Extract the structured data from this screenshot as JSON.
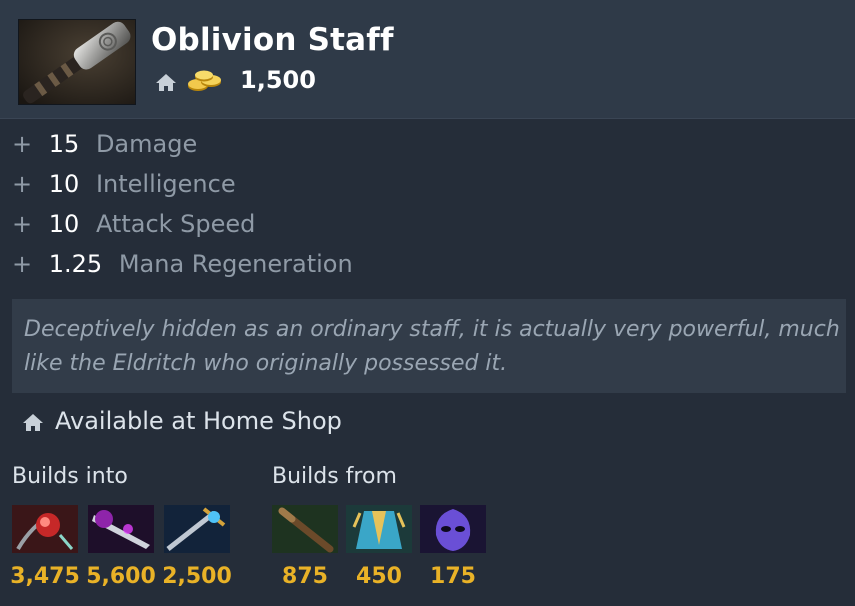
{
  "item": {
    "name": "Oblivion Staff",
    "cost": "1,500",
    "icon": "staff-icon"
  },
  "attributes": [
    {
      "plus": "+",
      "value": "15",
      "name": "Damage"
    },
    {
      "plus": "+",
      "value": "10",
      "name": "Intelligence"
    },
    {
      "plus": "+",
      "value": "10",
      "name": "Attack Speed"
    },
    {
      "plus": "+",
      "value": "1.25",
      "name": "Mana Regeneration"
    }
  ],
  "lore": "Deceptively hidden as an ordinary staff, it is actually very powerful, much like the Eldritch who originally possessed it.",
  "availability": "Available at Home Shop",
  "builds_into": {
    "label": "Builds into",
    "items": [
      {
        "icon": "red-orb-item-icon",
        "price": "3,475"
      },
      {
        "icon": "purple-blade-item-icon",
        "price": "5,600"
      },
      {
        "icon": "blue-sword-item-icon",
        "price": "2,500"
      }
    ]
  },
  "builds_from": {
    "label": "Builds from",
    "items": [
      {
        "icon": "quarterstaff-icon",
        "price": "875"
      },
      {
        "icon": "robe-icon",
        "price": "450"
      },
      {
        "icon": "mask-icon",
        "price": "175"
      }
    ]
  },
  "colors": {
    "background": "#252d39",
    "header": "#2f3a48",
    "lore_box": "#323c49",
    "gold": "#e9b227",
    "muted_text": "#8f9aa6"
  }
}
